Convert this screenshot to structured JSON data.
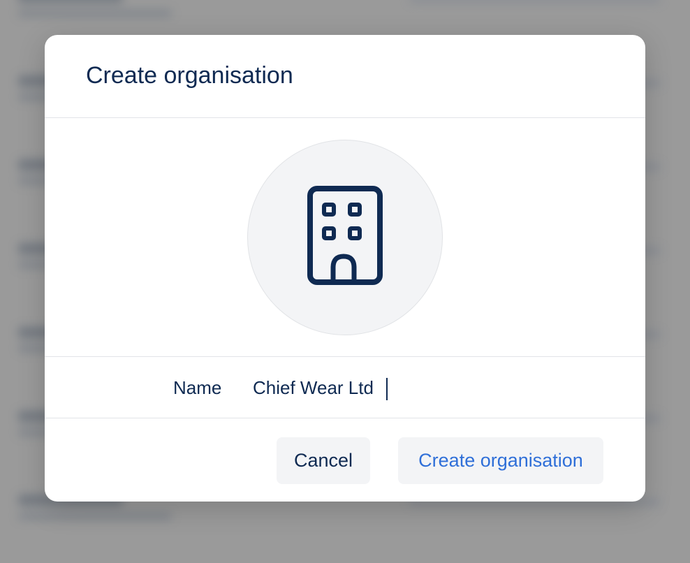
{
  "modal": {
    "title": "Create organisation",
    "avatar_icon": "office-building-icon",
    "name_label": "Name",
    "name_value": "Chief Wear Ltd",
    "cancel_label": "Cancel",
    "create_label": "Create organisation"
  },
  "colors": {
    "text_primary": "#0f2a52",
    "accent": "#2f6fd8",
    "button_bg": "#f3f4f6",
    "avatar_bg": "#f3f4f6",
    "backdrop": "#9a9a9a"
  }
}
